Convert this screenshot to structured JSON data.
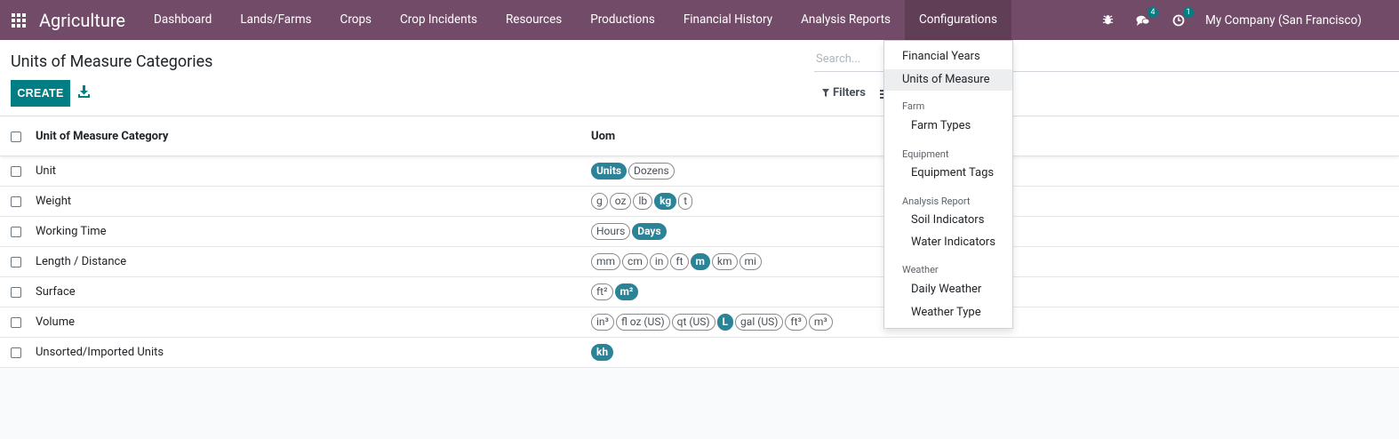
{
  "navbar": {
    "brand": "Agriculture",
    "menu": [
      "Dashboard",
      "Lands/Farms",
      "Crops",
      "Crop Incidents",
      "Resources",
      "Productions",
      "Financial History",
      "Analysis Reports",
      "Configurations"
    ],
    "messages_count": "4",
    "activities_count": "1",
    "company": "My Company (San Francisco)",
    "color": "#714b67"
  },
  "control_panel": {
    "title": "Units of Measure Categories",
    "create_label": "CREATE",
    "search_placeholder": "Search...",
    "filters_label": "Filters"
  },
  "list": {
    "columns": [
      "Unit of Measure Category",
      "Uom"
    ],
    "rows": [
      {
        "name": "Unit",
        "uoms": [
          {
            "t": "Units",
            "ref": true
          },
          {
            "t": "Dozens",
            "ref": false
          }
        ]
      },
      {
        "name": "Weight",
        "uoms": [
          {
            "t": "g",
            "ref": false
          },
          {
            "t": "oz",
            "ref": false
          },
          {
            "t": "lb",
            "ref": false
          },
          {
            "t": "kg",
            "ref": true
          },
          {
            "t": "t",
            "ref": false
          }
        ]
      },
      {
        "name": "Working Time",
        "uoms": [
          {
            "t": "Hours",
            "ref": false
          },
          {
            "t": "Days",
            "ref": true
          }
        ]
      },
      {
        "name": "Length / Distance",
        "uoms": [
          {
            "t": "mm",
            "ref": false
          },
          {
            "t": "cm",
            "ref": false
          },
          {
            "t": "in",
            "ref": false
          },
          {
            "t": "ft",
            "ref": false
          },
          {
            "t": "m",
            "ref": true
          },
          {
            "t": "km",
            "ref": false
          },
          {
            "t": "mi",
            "ref": false
          }
        ]
      },
      {
        "name": "Surface",
        "uoms": [
          {
            "t": "ft²",
            "ref": false
          },
          {
            "t": "m²",
            "ref": true
          }
        ]
      },
      {
        "name": "Volume",
        "uoms": [
          {
            "t": "in³",
            "ref": false
          },
          {
            "t": "fl oz (US)",
            "ref": false
          },
          {
            "t": "qt (US)",
            "ref": false
          },
          {
            "t": "L",
            "ref": true
          },
          {
            "t": "gal (US)",
            "ref": false
          },
          {
            "t": "ft³",
            "ref": false
          },
          {
            "t": "m³",
            "ref": false
          }
        ]
      },
      {
        "name": "Unsorted/Imported Units",
        "uoms": [
          {
            "t": "kh",
            "ref": true
          }
        ]
      }
    ],
    "ref_tag_color": "#2b8397"
  },
  "dropdown": {
    "items": [
      {
        "kind": "item",
        "label": "Financial Years",
        "active": false
      },
      {
        "kind": "item",
        "label": "Units of Measure",
        "active": true
      },
      {
        "kind": "header",
        "label": "Farm"
      },
      {
        "kind": "sub",
        "label": "Farm Types"
      },
      {
        "kind": "header",
        "label": "Equipment"
      },
      {
        "kind": "sub",
        "label": "Equipment Tags"
      },
      {
        "kind": "header",
        "label": "Analysis Report"
      },
      {
        "kind": "sub",
        "label": "Soil Indicators"
      },
      {
        "kind": "sub",
        "label": "Water Indicators"
      },
      {
        "kind": "header",
        "label": "Weather"
      },
      {
        "kind": "sub",
        "label": "Daily Weather"
      },
      {
        "kind": "sub",
        "label": "Weather Type"
      }
    ]
  }
}
